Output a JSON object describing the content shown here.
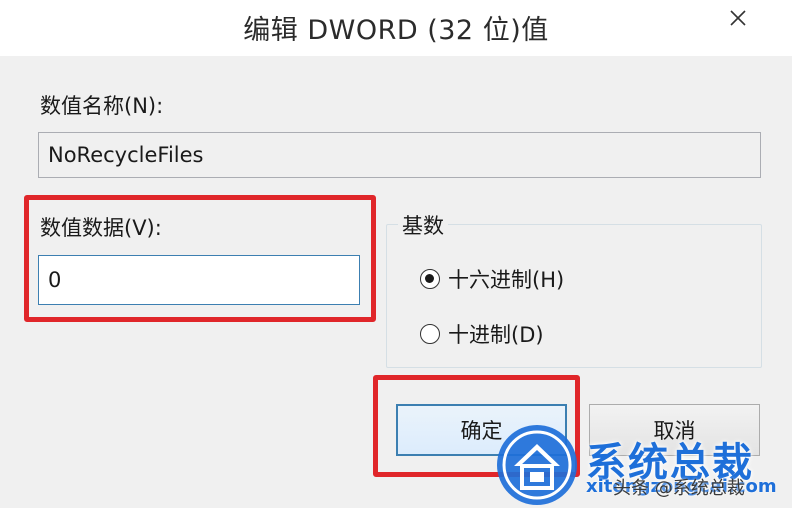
{
  "dialog": {
    "title": "编辑 DWORD (32 位)值",
    "close_icon": "close-icon"
  },
  "value_name": {
    "label": "数值名称(N):",
    "value": "NoRecycleFiles"
  },
  "value_data": {
    "label": "数值数据(V):",
    "value": "0"
  },
  "base": {
    "title": "基数",
    "options": [
      {
        "label": "十六进制(H)",
        "checked": true
      },
      {
        "label": "十进制(D)",
        "checked": false
      }
    ]
  },
  "buttons": {
    "ok_label": "确定",
    "cancel_label": "取消"
  },
  "watermark": {
    "brand": "系统总裁",
    "url": "xitongzongcai.com",
    "headline": "头条 @系统总裁"
  },
  "colors": {
    "highlight": "#e0262a",
    "focus_border": "#3c7fb1",
    "watermark": "#1e6fd9"
  }
}
